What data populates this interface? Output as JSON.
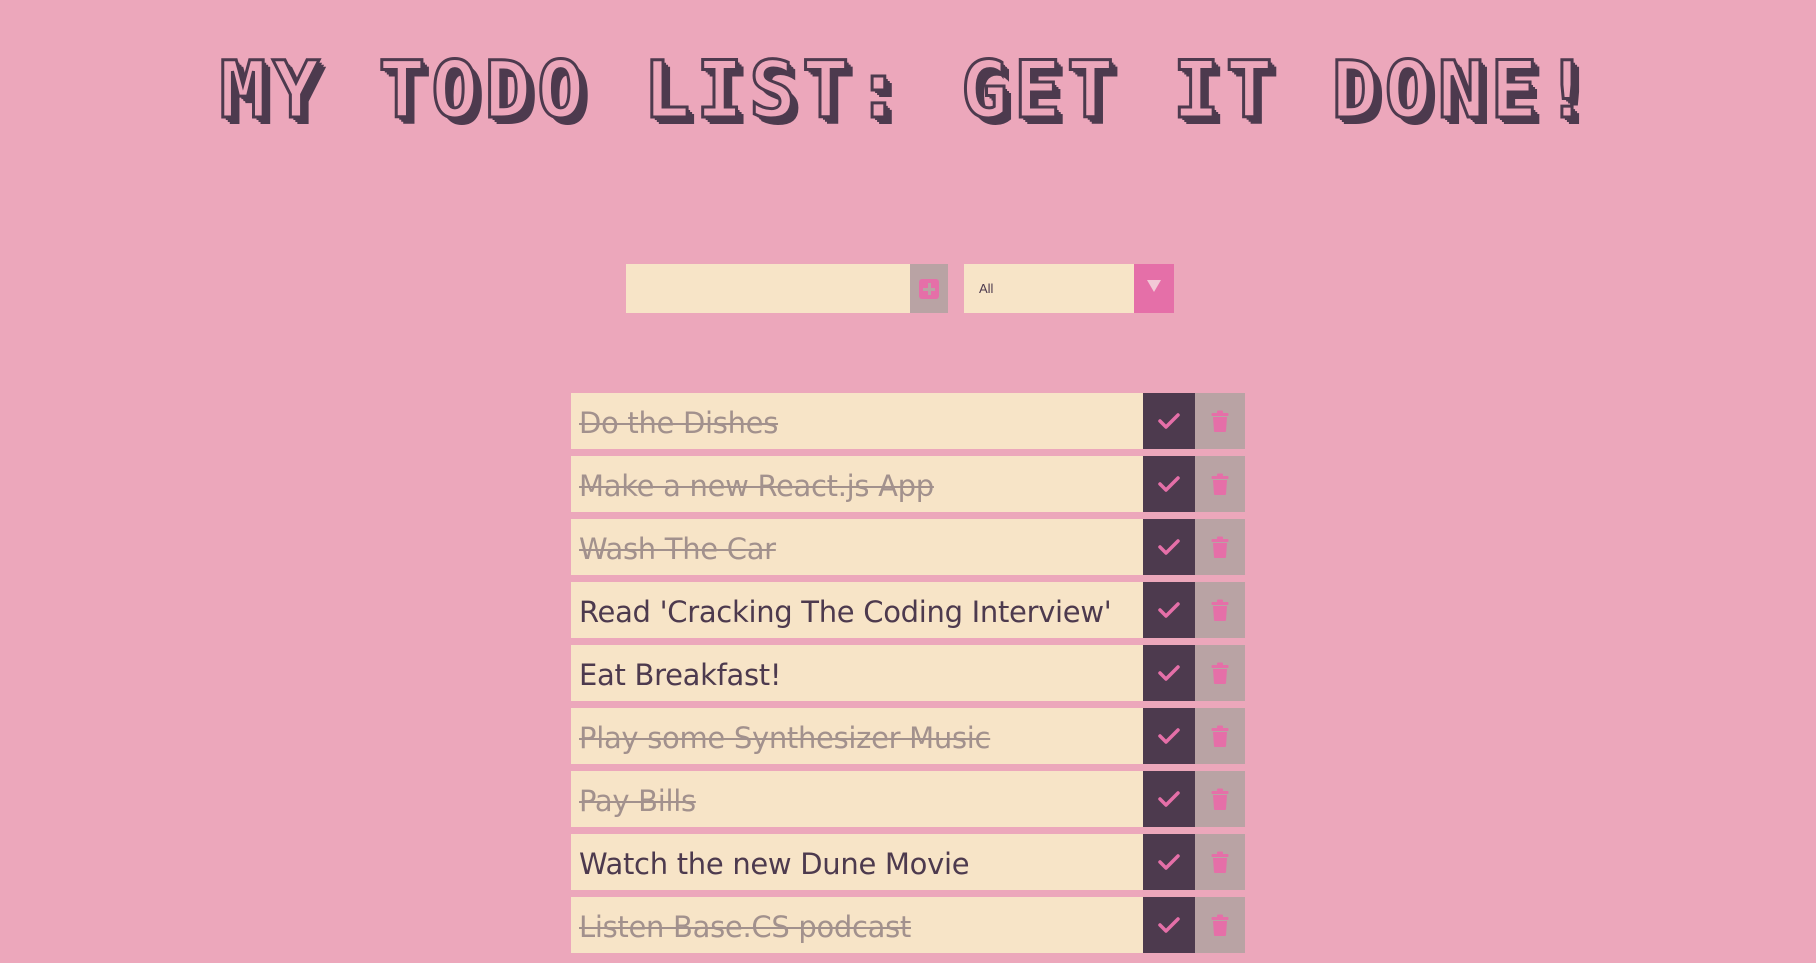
{
  "header": {
    "title": "MY TODO LIST: GET IT DONE!"
  },
  "form": {
    "input_value": "",
    "input_placeholder": "",
    "add_icon": "plus-square-icon",
    "filter_selected": "All",
    "filter_icon": "caret-down-icon"
  },
  "todos": [
    {
      "text": "Do the Dishes",
      "completed": true
    },
    {
      "text": "Make a new React.js App",
      "completed": true
    },
    {
      "text": "Wash The Car",
      "completed": true
    },
    {
      "text": "Read 'Cracking The Coding Interview'",
      "completed": false
    },
    {
      "text": "Eat Breakfast!",
      "completed": false
    },
    {
      "text": "Play some Synthesizer Music",
      "completed": true
    },
    {
      "text": "Pay Bills",
      "completed": true
    },
    {
      "text": "Watch the new Dune Movie",
      "completed": false
    },
    {
      "text": "Listen Base.CS podcast",
      "completed": true
    }
  ],
  "icons": {
    "complete": "check-icon",
    "delete": "trash-icon"
  },
  "colors": {
    "background": "#ECA7BB",
    "accent_pink": "#E56FA8",
    "dark_plum": "#4D3A4E",
    "cream": "#F7E4C7",
    "muted_gray": "#B9A3A4"
  }
}
